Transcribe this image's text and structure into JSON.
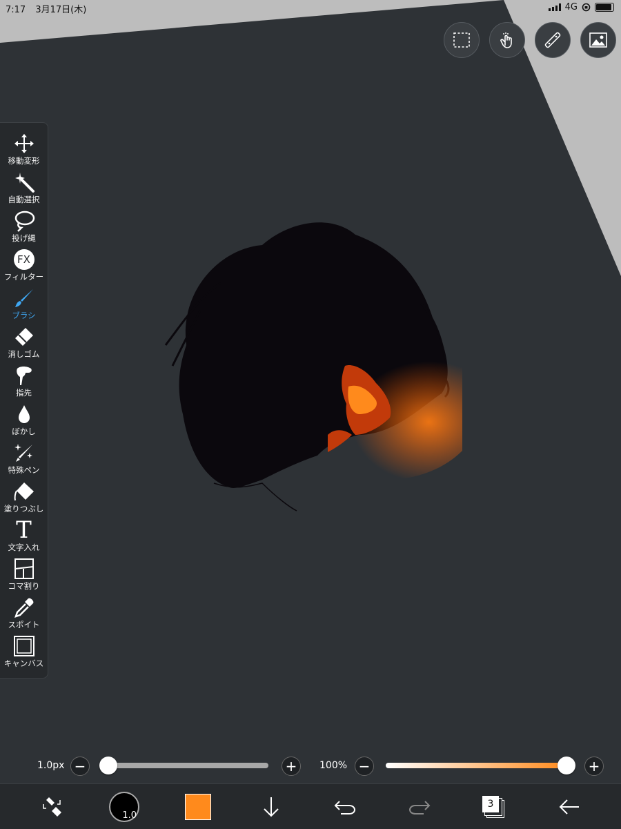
{
  "status_bar": {
    "time": "7:17",
    "date": "3月17日(木)",
    "network": "4G"
  },
  "top_buttons": [
    {
      "name": "selection-icon"
    },
    {
      "name": "gesture-hand-icon"
    },
    {
      "name": "ruler-icon"
    },
    {
      "name": "image-icon"
    }
  ],
  "tools": [
    {
      "id": "move",
      "label": "移動変形",
      "icon": "move-arrows-icon"
    },
    {
      "id": "magic",
      "label": "自動選択",
      "icon": "magic-wand-icon"
    },
    {
      "id": "lasso",
      "label": "投げ縄",
      "icon": "lasso-icon"
    },
    {
      "id": "filter",
      "label": "フィルター",
      "icon": "fx-icon",
      "glyph": "FX"
    },
    {
      "id": "brush",
      "label": "ブラシ",
      "icon": "brush-icon",
      "active": true
    },
    {
      "id": "eraser",
      "label": "消しゴム",
      "icon": "eraser-icon"
    },
    {
      "id": "finger",
      "label": "指先",
      "icon": "finger-smudge-icon"
    },
    {
      "id": "blur",
      "label": "ぼかし",
      "icon": "blur-drop-icon"
    },
    {
      "id": "special",
      "label": "特殊ペン",
      "icon": "special-pen-icon"
    },
    {
      "id": "fill",
      "label": "塗りつぶし",
      "icon": "bucket-fill-icon"
    },
    {
      "id": "text",
      "label": "文字入れ",
      "icon": "text-icon",
      "glyph": "T"
    },
    {
      "id": "frame",
      "label": "コマ割り",
      "icon": "frame-divide-icon"
    },
    {
      "id": "eyedropper",
      "label": "スポイト",
      "icon": "eyedropper-icon"
    },
    {
      "id": "canvas",
      "label": "キャンバス",
      "icon": "canvas-icon"
    }
  ],
  "brush_size": {
    "value_label": "1.0px",
    "minus": "−",
    "plus": "+",
    "level": 0.0
  },
  "opacity": {
    "value_label": "100%",
    "minus": "−",
    "plus": "+",
    "level": 1.0
  },
  "bottom_bar": {
    "brush_preview_label": "1.0",
    "color": "#ff8a1c",
    "layers_count": "3"
  },
  "colors": {
    "accent_blue": "#3fa8f4",
    "orange": "#ff8a1c",
    "canvas": "#2e3236"
  }
}
